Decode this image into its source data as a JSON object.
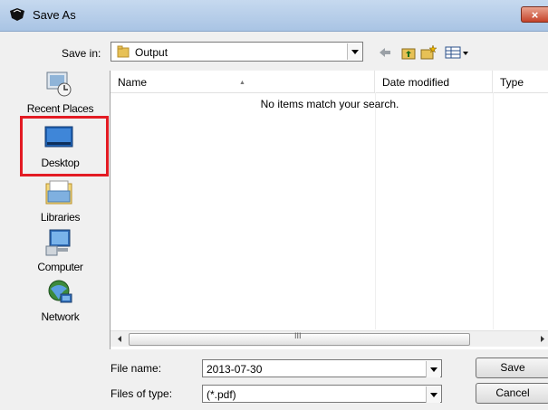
{
  "window": {
    "title": "Save As",
    "close_glyph": "×"
  },
  "save_in": {
    "label": "Save in:",
    "value": "Output"
  },
  "toolbar": {
    "icons": [
      "back-arrow-icon",
      "up-folder-icon",
      "new-folder-icon",
      "view-menu-icon"
    ]
  },
  "places": [
    {
      "label": "Recent Places",
      "icon": "recent-places-icon"
    },
    {
      "label": "Desktop",
      "icon": "desktop-icon"
    },
    {
      "label": "Libraries",
      "icon": "libraries-icon"
    },
    {
      "label": "Computer",
      "icon": "computer-icon"
    },
    {
      "label": "Network",
      "icon": "network-icon"
    }
  ],
  "file_list": {
    "columns": [
      "Name",
      "Date modified",
      "Type"
    ],
    "empty_message": "No items match your search.",
    "scroll_grip": "III"
  },
  "file_name": {
    "label": "File name:",
    "value": "2013-07-30"
  },
  "file_type": {
    "label": "Files of type:",
    "value": "(*.pdf)"
  },
  "buttons": {
    "save": "Save",
    "cancel": "Cancel"
  },
  "colors": {
    "highlight": "#e31b23",
    "titlebar": "#b4cde9"
  }
}
